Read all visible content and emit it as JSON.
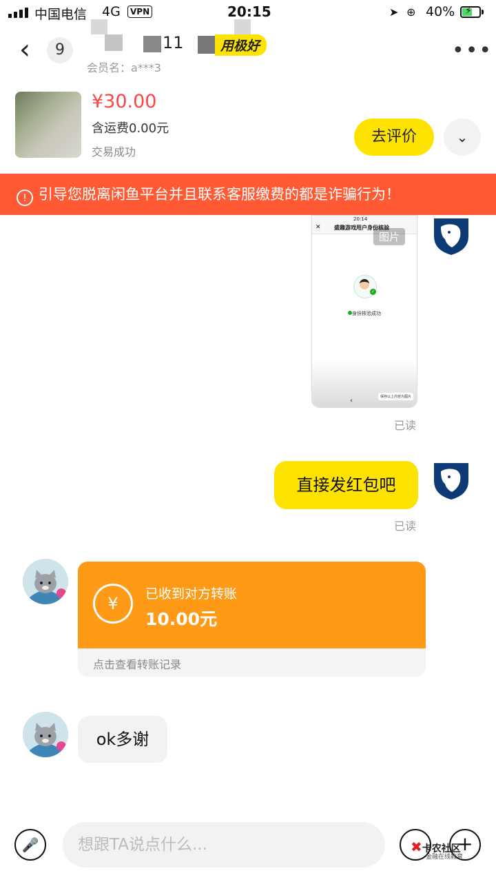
{
  "status_bar": {
    "carrier": "中国电信",
    "network": "4G",
    "vpn": "VPN",
    "time": "20:15",
    "battery": "40%"
  },
  "header": {
    "unread_count": "9",
    "name_visible": "11",
    "credit_badge": "用极好",
    "member": "会员名：a***3"
  },
  "product": {
    "price": "¥30.00",
    "shipping": "含运费0.00元",
    "status": "交易成功",
    "review_button": "去评价"
  },
  "warning": {
    "icon": "!",
    "text": "引导您脱离闲鱼平台并且联系客服缴费的都是诈骗行为！"
  },
  "messages": {
    "image_tag": "图片",
    "shot_title": "盛趣游戏用户身份核验",
    "shot_time": "20:14",
    "shot_success": "身份核验成功",
    "shot_save": "保存以上内容为图片",
    "read1": "已读",
    "text_me": "直接发红包吧",
    "read2": "已读",
    "transfer": {
      "title": "已收到对方转账",
      "amount": "10.00元",
      "link": "点击查看转账记录",
      "currency_symbol": "¥"
    },
    "text_other": "ok多谢"
  },
  "input_bar": {
    "placeholder": "想跟TA说点什么..."
  },
  "watermark": {
    "brand": "卡农社区",
    "sub": "金融在线教育"
  }
}
